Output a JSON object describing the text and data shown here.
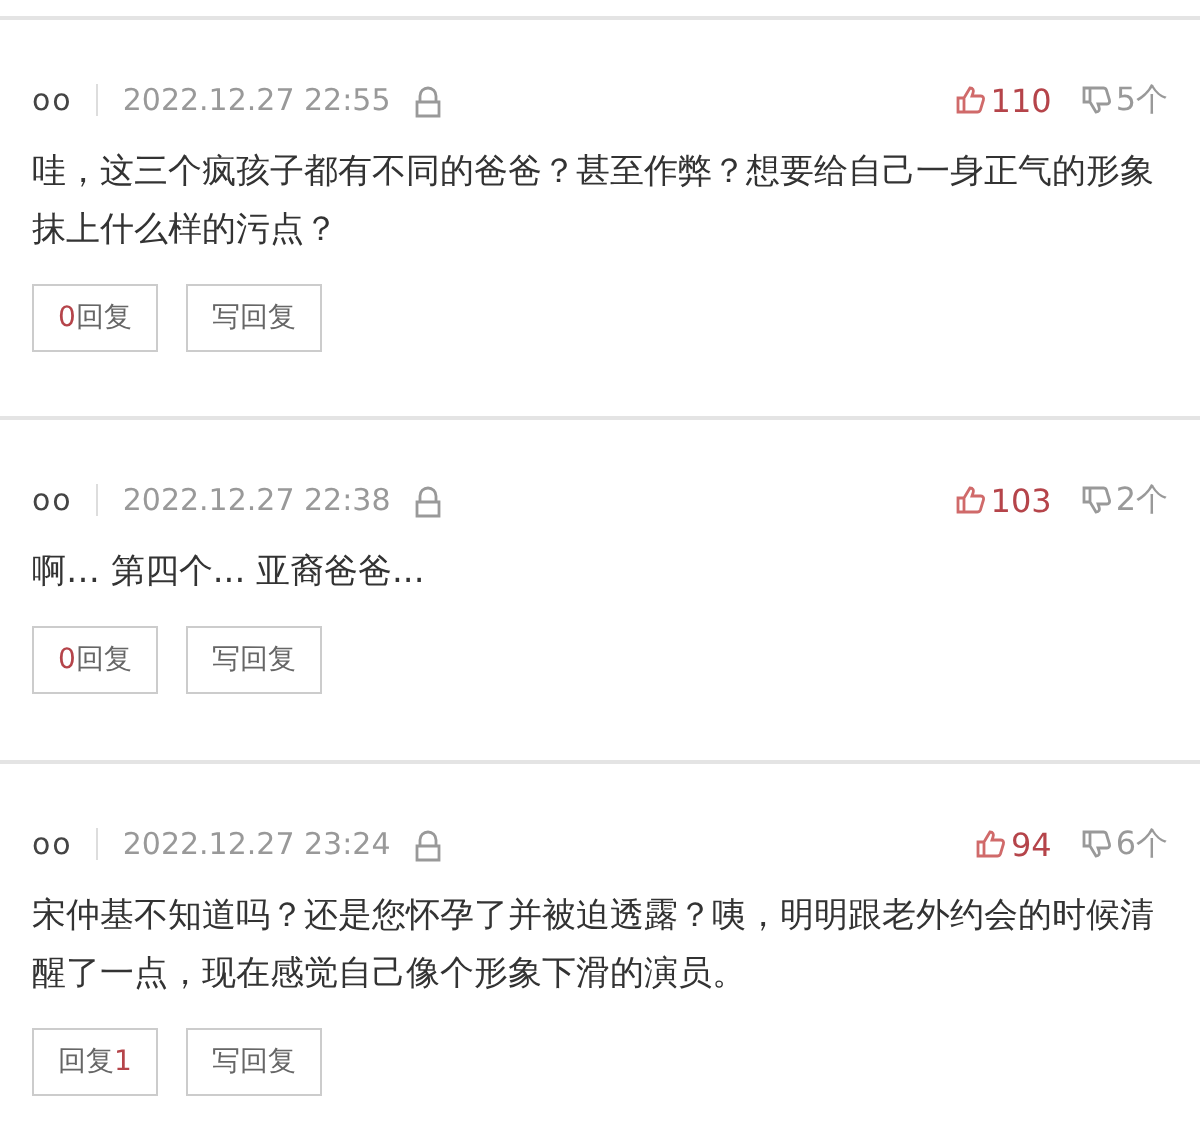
{
  "comments": [
    {
      "user": "oo",
      "time": "2022.12.27 22:55",
      "likes": "110",
      "dislikes": "5个",
      "text": "哇，这三个疯孩子都有不同的爸爸？甚至作弊？想要给自己一身正气的形象抹上什么样的污点？",
      "reply_parts": [
        {
          "kind": "count",
          "text": "0"
        },
        {
          "kind": "label",
          "text": "回复"
        }
      ],
      "write_reply": "写回复"
    },
    {
      "user": "oo",
      "time": "2022.12.27 22:38",
      "likes": "103",
      "dislikes": "2个",
      "text": "啊… 第四个... 亚裔爸爸...",
      "reply_parts": [
        {
          "kind": "count",
          "text": "0"
        },
        {
          "kind": "label",
          "text": "回复"
        }
      ],
      "write_reply": "写回复"
    },
    {
      "user": "oo",
      "time": "2022.12.27 23:24",
      "likes": "94",
      "dislikes": "6个",
      "text": "宋仲基不知道吗？还是您怀孕了并被迫透露？咦，明明跟老外约会的时候清醒了一点，现在感觉自己像个形象下滑的演员。",
      "reply_parts": [
        {
          "kind": "label",
          "text": "回复"
        },
        {
          "kind": "count",
          "text": "1"
        }
      ],
      "write_reply": "写回复"
    }
  ]
}
